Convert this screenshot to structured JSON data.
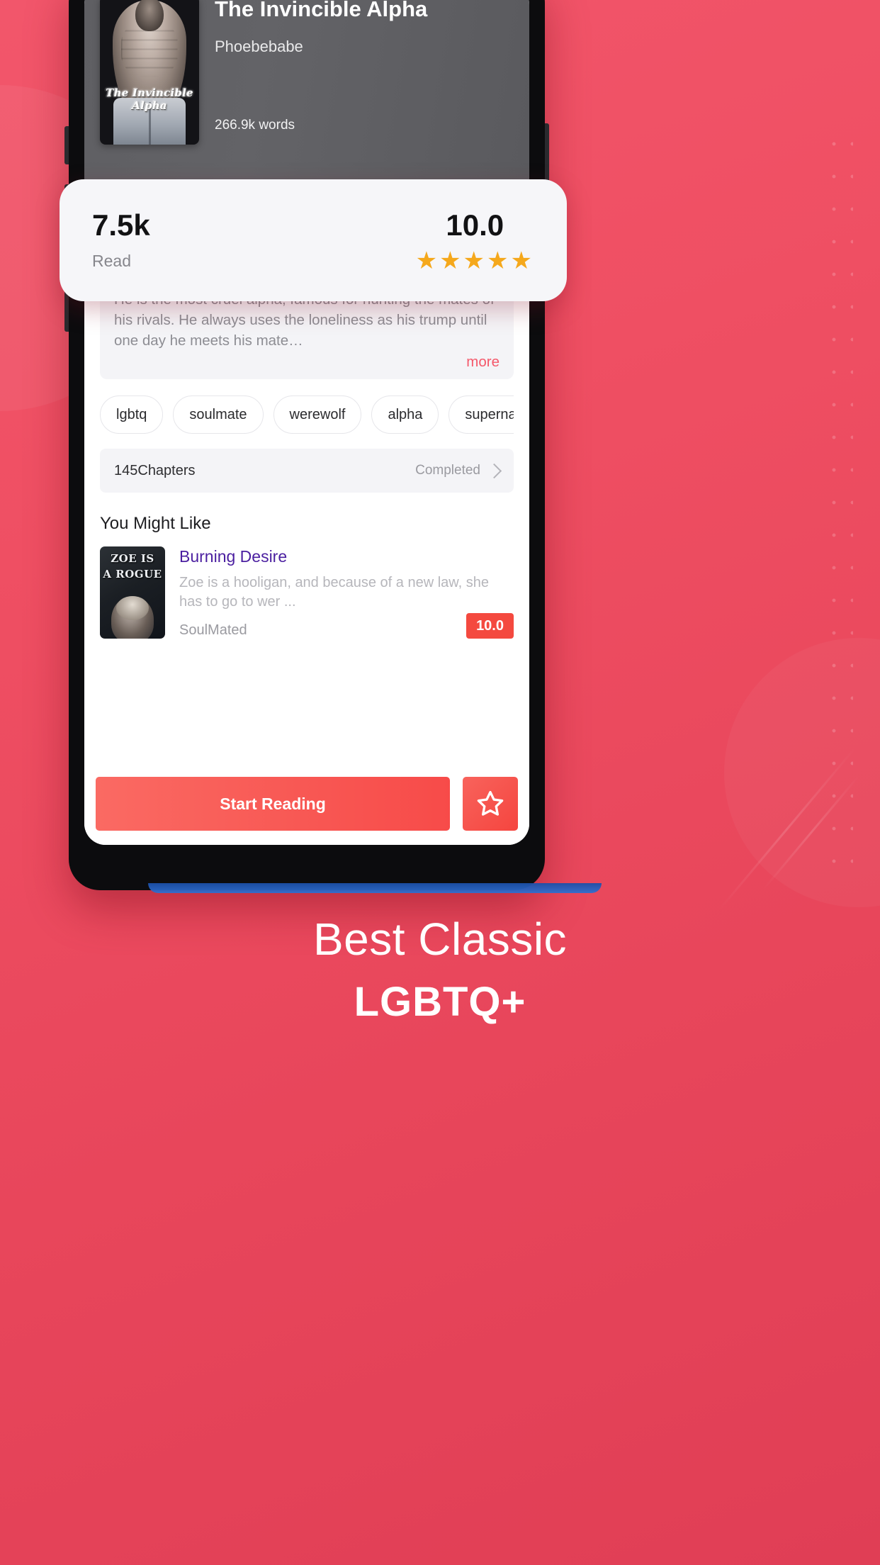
{
  "book": {
    "title": "The Invincible Alpha",
    "author": "Phoebebabe",
    "words": "266.9k words",
    "cover_caption": "The Invincible Alpha"
  },
  "stats": {
    "read_count": "7.5k",
    "read_label": "Read",
    "score": "10.0",
    "stars": "★★★★★",
    "star_count": 5
  },
  "description": {
    "text": "He is the most cruel alpha, famous for hunting the mates of his rivals. He always uses the loneliness as his trump until one day he meets his mate…",
    "more_label": "more"
  },
  "tags": [
    {
      "label": "lgbtq"
    },
    {
      "label": "soulmate"
    },
    {
      "label": "werewolf"
    },
    {
      "label": "alpha"
    },
    {
      "label": "supernatu"
    }
  ],
  "chapters": {
    "count_label": "145Chapters",
    "status_label": "Completed"
  },
  "recommendations": {
    "section_title": "You Might Like",
    "items": [
      {
        "cover_line1": "ZOE IS",
        "cover_line2": "A ROGUE",
        "title": "Burning Desire",
        "desc": "Zoe is a hooligan, and because of a new law, she has to go to wer ...",
        "category": "SoulMated",
        "score": "10.0"
      }
    ]
  },
  "bottom_bar": {
    "read_button": "Start Reading",
    "favorite_icon": "star-outline-icon"
  },
  "caption": {
    "line1": "Best Classic",
    "line2": "LGBTQ+"
  },
  "colors": {
    "background_pink": "#ef4f63",
    "accent_red": "#f4493f",
    "star_gold": "#f5a81c",
    "rec_title_purple": "#4b1fa0",
    "more_link": "#f4586a"
  }
}
